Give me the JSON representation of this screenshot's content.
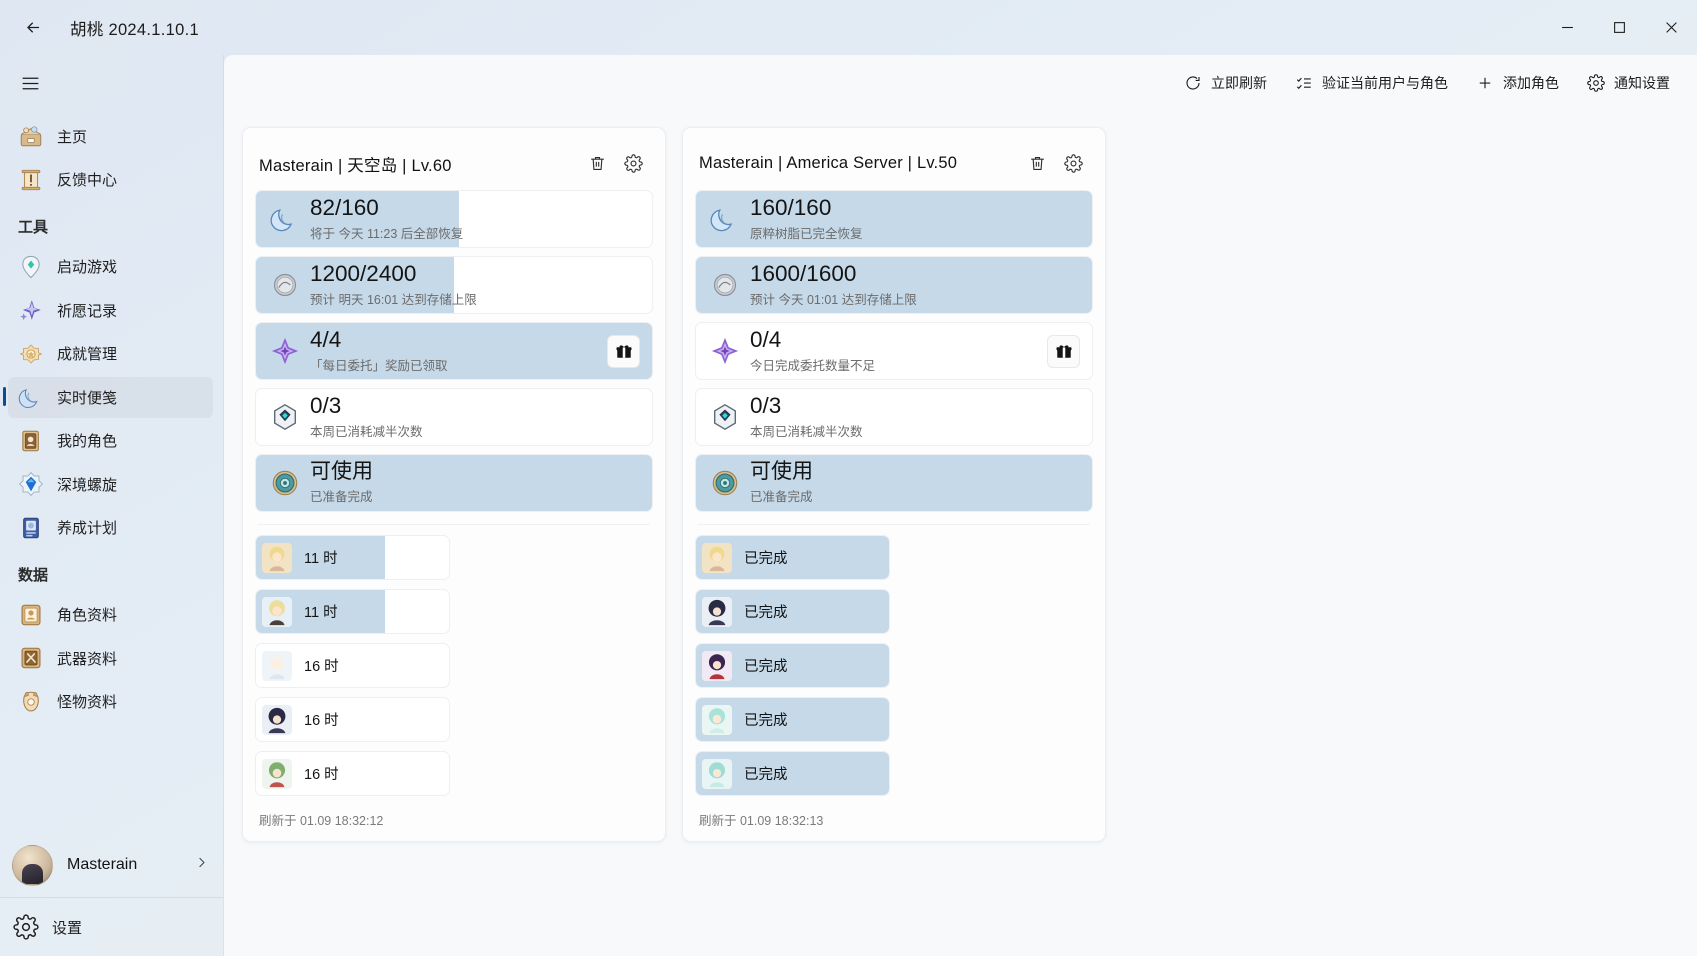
{
  "window": {
    "title": "胡桃 2024.1.10.1",
    "back_icon": "arrow-left-icon",
    "minimize_icon": "minimize-icon",
    "maximize_icon": "maximize-icon",
    "close_icon": "close-icon"
  },
  "sidebar": {
    "menu_icon": "hamburger-icon",
    "items": [
      {
        "label": "主页",
        "icon": "home-icon",
        "active": false,
        "group": null
      },
      {
        "label": "反馈中心",
        "icon": "feedback-icon",
        "active": false,
        "group": null
      },
      {
        "label": "工具",
        "group_header": true
      },
      {
        "label": "启动游戏",
        "icon": "launch-game-icon",
        "active": false
      },
      {
        "label": "祈愿记录",
        "icon": "wish-record-icon",
        "active": false
      },
      {
        "label": "成就管理",
        "icon": "achievement-icon",
        "active": false
      },
      {
        "label": "实时便笺",
        "icon": "real-time-notes-icon",
        "active": true
      },
      {
        "label": "我的角色",
        "icon": "my-characters-icon",
        "active": false
      },
      {
        "label": "深境螺旋",
        "icon": "spiral-abyss-icon",
        "active": false
      },
      {
        "label": "养成计划",
        "icon": "cultivation-plan-icon",
        "active": false
      },
      {
        "label": "数据",
        "group_header": true
      },
      {
        "label": "角色资料",
        "icon": "character-data-icon",
        "active": false
      },
      {
        "label": "武器资料",
        "icon": "weapon-data-icon",
        "active": false
      },
      {
        "label": "怪物资料",
        "icon": "monster-data-icon",
        "active": false
      }
    ],
    "user": {
      "name": "Masterain",
      "avatar_icon": "user-avatar",
      "chevron_icon": "chevron-right-icon"
    },
    "settings": {
      "label": "设置",
      "icon": "gear-icon"
    }
  },
  "toolbar": {
    "buttons": [
      {
        "label": "立即刷新",
        "icon": "refresh-icon"
      },
      {
        "label": "验证当前用户与角色",
        "icon": "verify-icon"
      },
      {
        "label": "添加角色",
        "icon": "plus-icon"
      },
      {
        "label": "通知设置",
        "icon": "gear-icon"
      }
    ]
  },
  "cards": [
    {
      "title": "Masterain | 天空岛 | Lv.60",
      "delete_icon": "trash-icon",
      "settings_icon": "gear-icon",
      "stats": [
        {
          "icon": "resin-moon-icon",
          "value": "82/160",
          "sub": "将于 今天 11:23 后全部恢复",
          "progress": 51.3,
          "gift": false
        },
        {
          "icon": "realm-currency-icon",
          "value": "1200/2400",
          "sub": "预计 明天 16:01 达到存储上限",
          "progress": 50.0,
          "gift": false
        },
        {
          "icon": "daily-commission-icon",
          "value": "4/4",
          "sub": "「每日委托」奖励已领取",
          "progress": 100,
          "gift": true,
          "gift_icon": "gift-icon"
        },
        {
          "icon": "resin-discount-icon",
          "value": "0/3",
          "sub": "本周已消耗减半次数",
          "progress": 0,
          "gift": false
        },
        {
          "icon": "transformer-icon",
          "value": "可使用",
          "sub": "已准备完成",
          "progress": 100,
          "gift": false
        }
      ],
      "expeditions": [
        {
          "label": "11 时",
          "progress": 67,
          "avatar": "char-noelle"
        },
        {
          "label": "11 时",
          "progress": 67,
          "avatar": "char-aether"
        },
        {
          "label": "16 时",
          "progress": 0,
          "avatar": "char-paimon"
        },
        {
          "label": "16 时",
          "progress": 0,
          "avatar": "char-scaramouche"
        },
        {
          "label": "16 时",
          "progress": 0,
          "avatar": "char-collei"
        }
      ],
      "footer": "刷新于 01.09 18:32:12"
    },
    {
      "title": "Masterain | America Server | Lv.50",
      "delete_icon": "trash-icon",
      "settings_icon": "gear-icon",
      "stats": [
        {
          "icon": "resin-moon-icon",
          "value": "160/160",
          "sub": "原粹树脂已完全恢复",
          "progress": 100,
          "gift": false
        },
        {
          "icon": "realm-currency-icon",
          "value": "1600/1600",
          "sub": "预计 今天 01:01 达到存储上限",
          "progress": 100,
          "gift": false
        },
        {
          "icon": "daily-commission-icon",
          "value": "0/4",
          "sub": "今日完成委托数量不足",
          "progress": 0,
          "gift": true,
          "gift_icon": "gift-icon"
        },
        {
          "icon": "resin-discount-icon",
          "value": "0/3",
          "sub": "本周已消耗减半次数",
          "progress": 0,
          "gift": false
        },
        {
          "icon": "transformer-icon",
          "value": "可使用",
          "sub": "已准备完成",
          "progress": 100,
          "gift": false
        }
      ],
      "expeditions": [
        {
          "label": "已完成",
          "progress": 100,
          "avatar": "char-noelle"
        },
        {
          "label": "已完成",
          "progress": 100,
          "avatar": "char-scaramouche"
        },
        {
          "label": "已完成",
          "progress": 100,
          "avatar": "char-fischl"
        },
        {
          "label": "已完成",
          "progress": 100,
          "avatar": "char-sucrose"
        },
        {
          "label": "已完成",
          "progress": 100,
          "avatar": "char-sayu"
        }
      ],
      "footer": "刷新于 01.09 18:32:13"
    }
  ],
  "colors": {
    "accent": "#0f4c8f",
    "progress_fill": "#c5d9e9",
    "card_bg": "#fdfdfe",
    "content_bg": "#f7f9fb"
  }
}
